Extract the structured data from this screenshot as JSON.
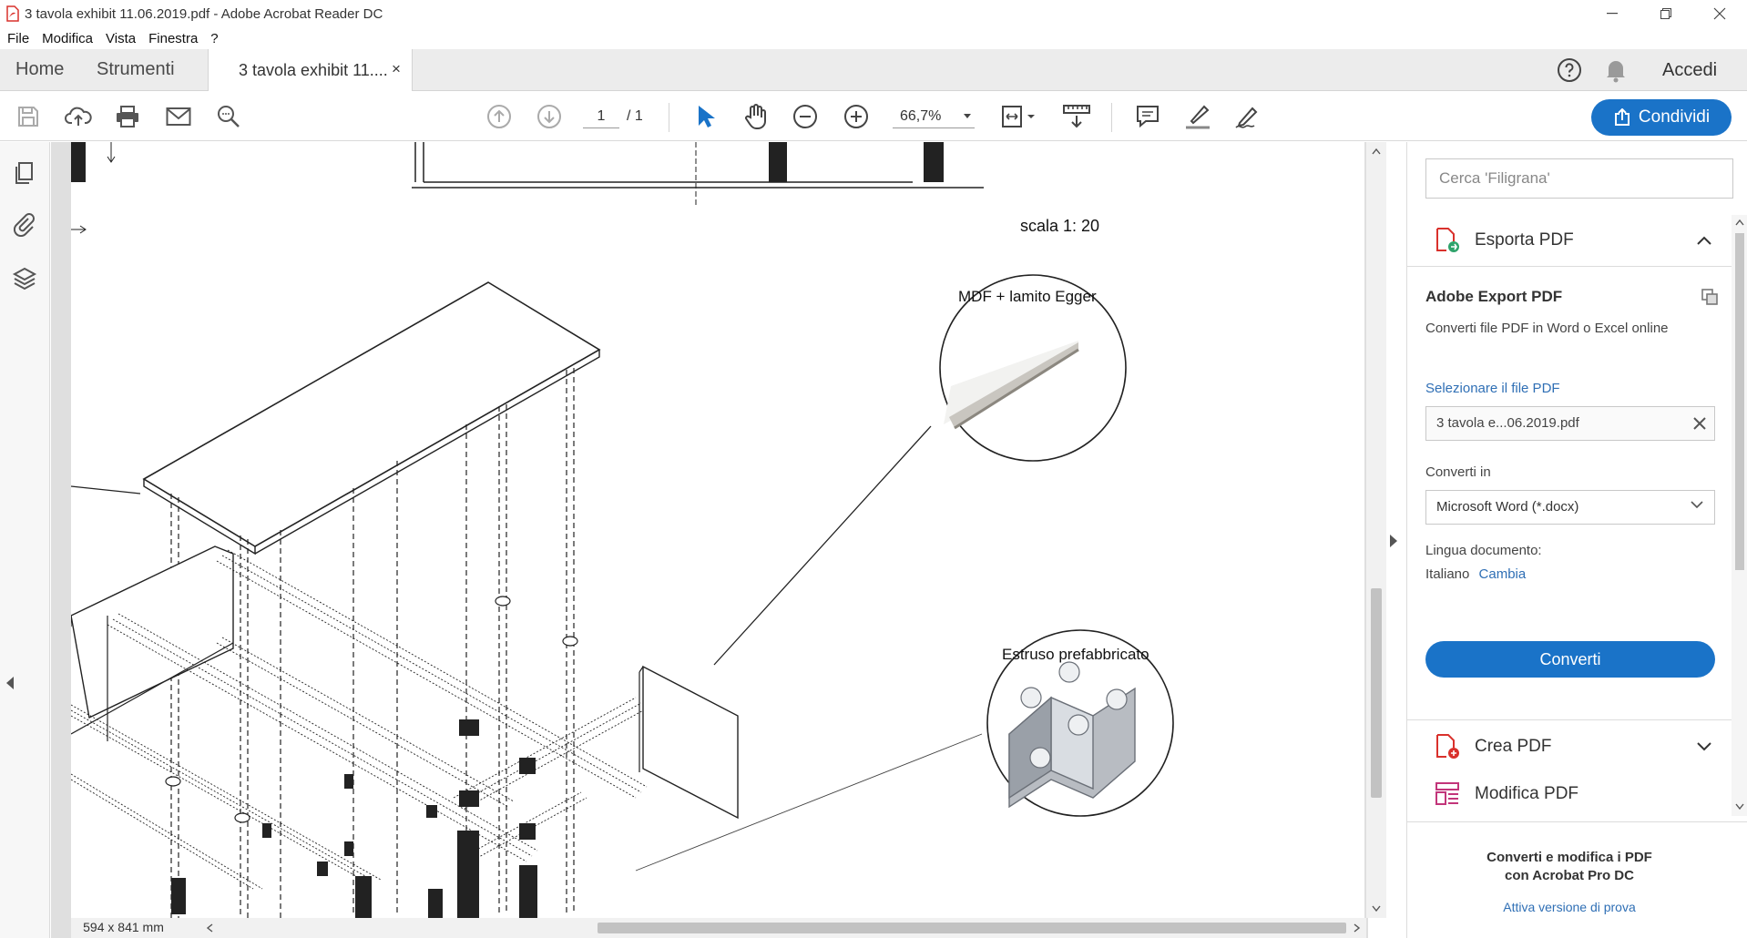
{
  "window": {
    "title": "3 tavola exhibit 11.06.2019.pdf - Adobe Acrobat Reader DC"
  },
  "menu": [
    "File",
    "Modifica",
    "Vista",
    "Finestra",
    "?"
  ],
  "tabs": {
    "home": "Home",
    "tools": "Strumenti",
    "document": "3 tavola exhibit 11....",
    "close": "×"
  },
  "header": {
    "signin": "Accedi"
  },
  "toolbar": {
    "page_current": "1",
    "page_total": "/ 1",
    "zoom": "66,7%",
    "share_label": "Condividi"
  },
  "drawing": {
    "scale": "scala 1: 20",
    "callout_1": "MDF + lamito Egger",
    "callout_2": "Estruso prefabbricato"
  },
  "status": {
    "page_size": "594 x 841 mm"
  },
  "right_panel": {
    "search_placeholder": "Cerca 'Filigrana'",
    "export_section": "Esporta PDF",
    "export_title": "Adobe Export PDF",
    "export_subtitle": "Converti file PDF in Word o Excel online",
    "select_file_link": "Selezionare il file PDF",
    "file_name": "3 tavola e...06.2019.pdf",
    "convert_to_label": "Converti in",
    "convert_to_value": "Microsoft Word (*.docx)",
    "language_label": "Lingua documento:",
    "language_value": "Italiano",
    "language_change": "Cambia",
    "convert_button": "Converti",
    "create_section": "Crea PDF",
    "edit_section": "Modifica PDF",
    "promo_line1": "Converti e modifica i PDF",
    "promo_line2": "con Acrobat Pro DC",
    "promo_link": "Attiva versione di prova"
  },
  "colors": {
    "accent": "#1a73c8",
    "link": "#2f6fb5",
    "acrobat_red": "#d9312c"
  }
}
